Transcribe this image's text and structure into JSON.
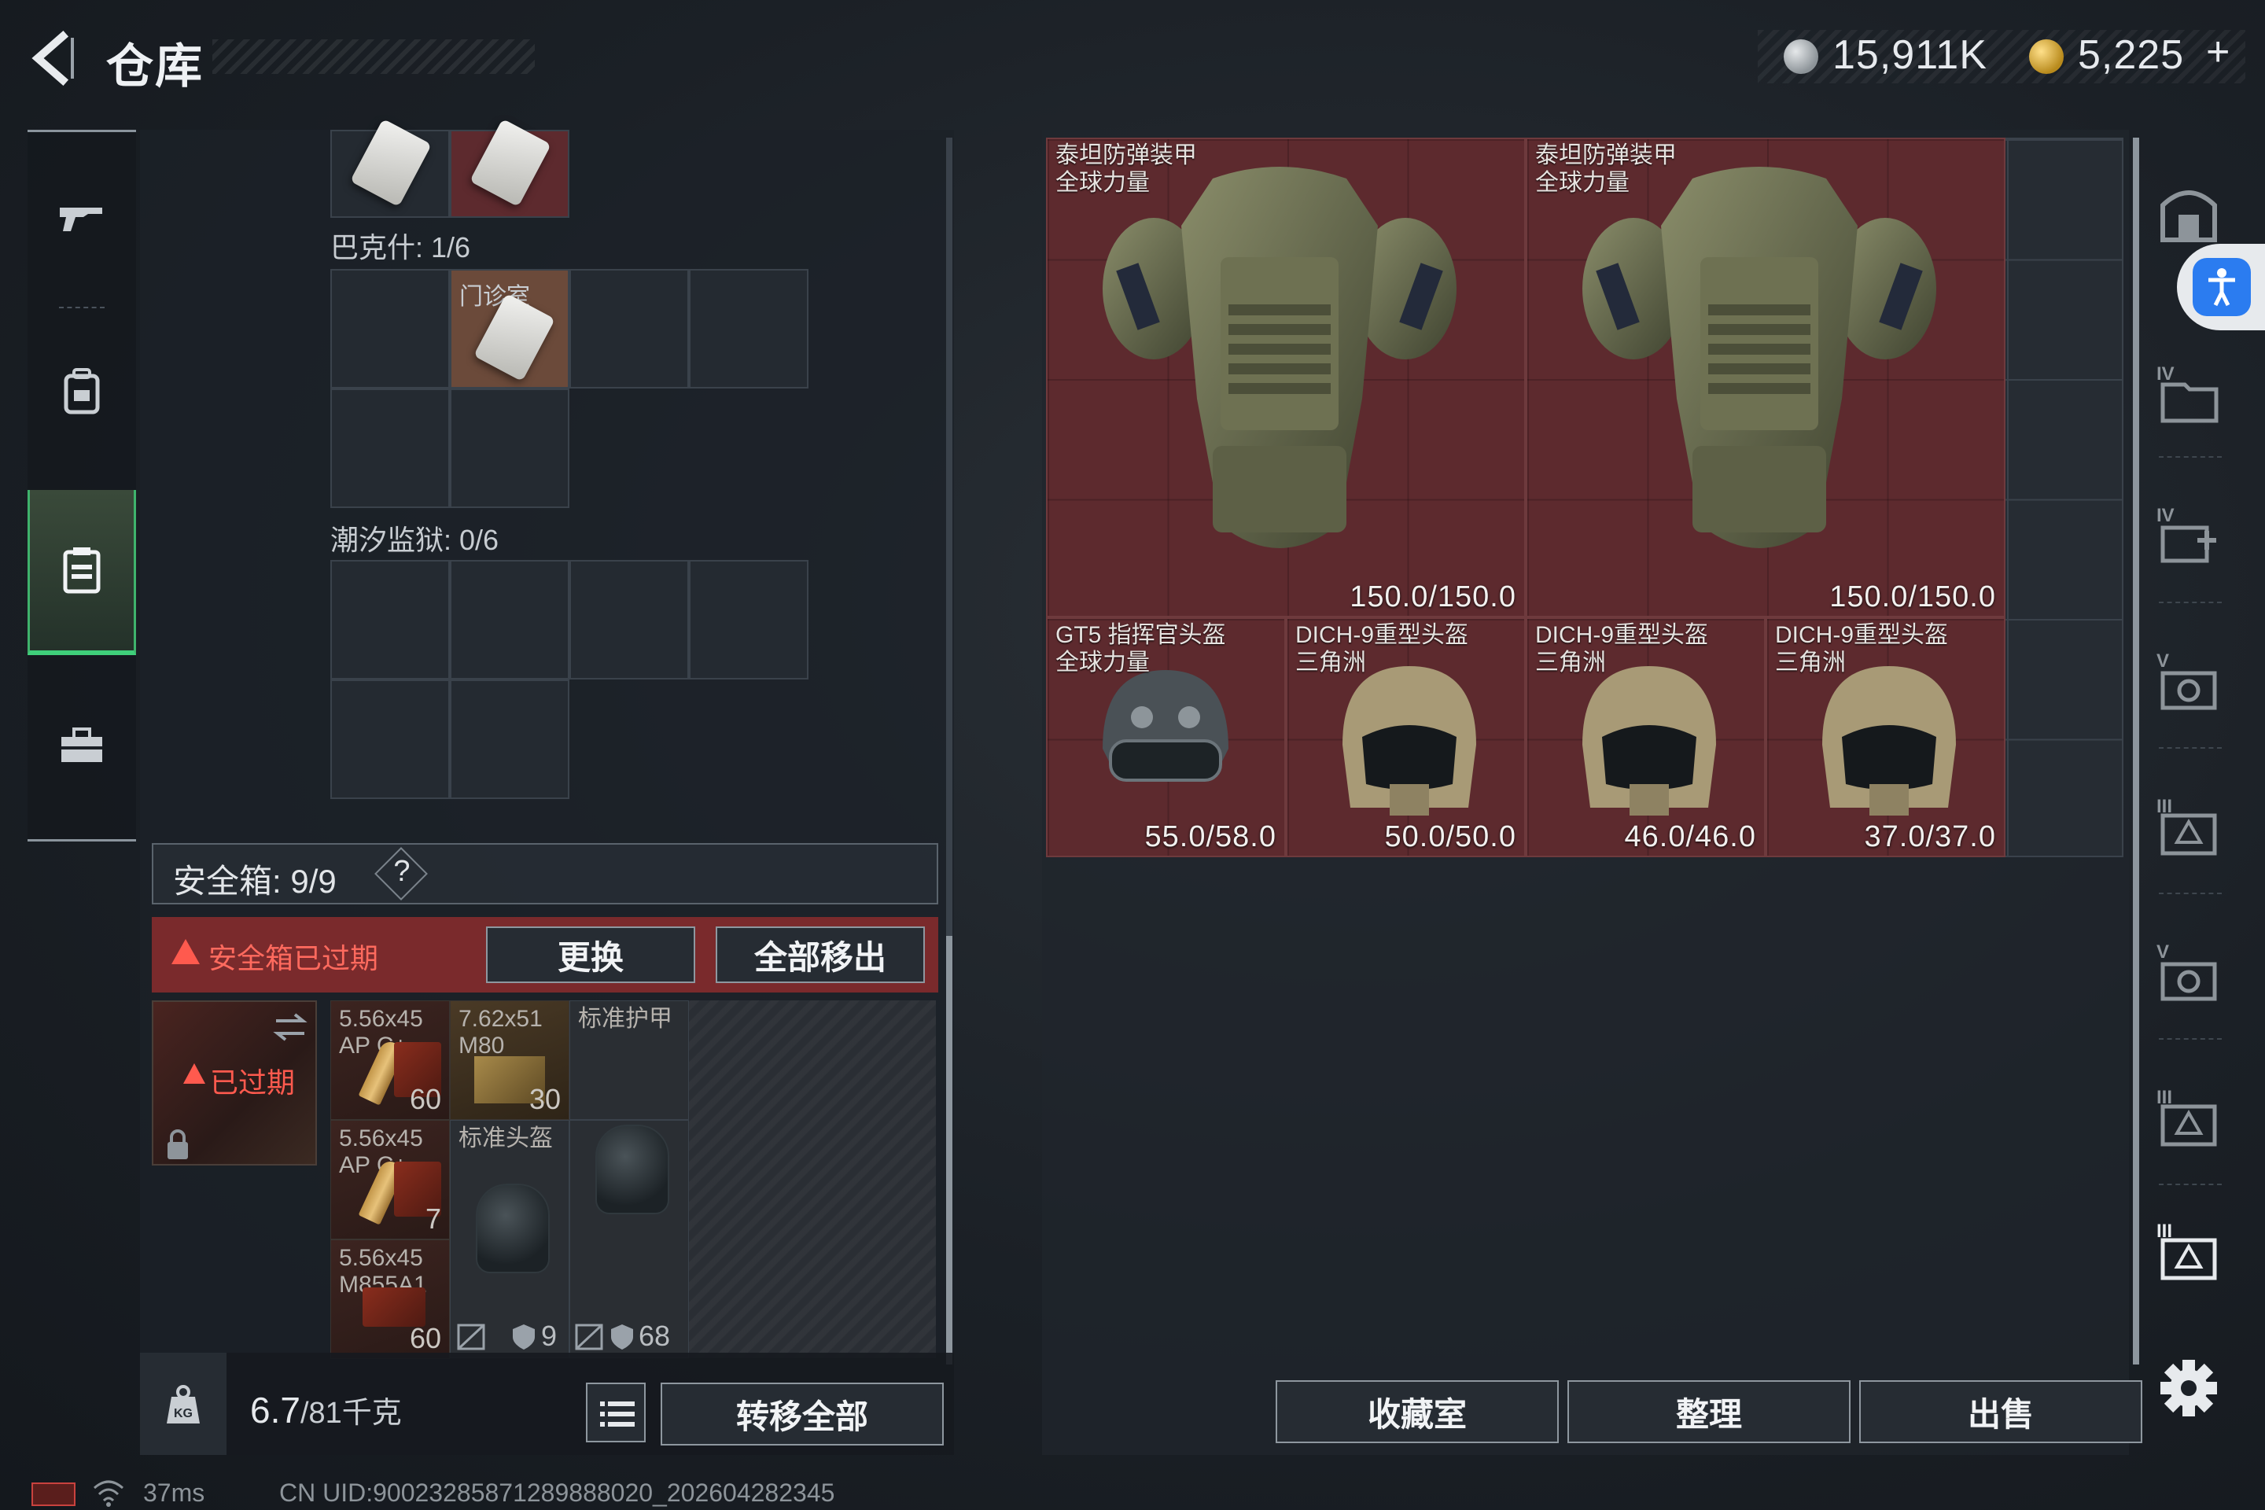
{
  "header": {
    "title": "仓库",
    "currency1_value": "15,911K",
    "currency2_value": "5,225",
    "currency2_add": "+"
  },
  "left_nav": {
    "items": [
      {
        "name": "weapons",
        "icon": "gun-icon"
      },
      {
        "name": "backpack",
        "icon": "backpack-icon"
      },
      {
        "name": "containers",
        "icon": "container-icon",
        "active": true
      },
      {
        "name": "toolbox",
        "icon": "toolbox-icon"
      }
    ]
  },
  "containers": {
    "top_card_label": "",
    "bakesh_label": "巴克什: 1/6",
    "clinic_key_label": "门诊室",
    "tide_prison_label": "潮汐监狱: 0/6"
  },
  "safe_box": {
    "label": "安全箱: 9/9",
    "help": "?",
    "expired_warning": "安全箱已过期",
    "replace_btn": "更换",
    "remove_all_btn": "全部移出",
    "thumb_status": "已过期",
    "items": [
      {
        "name": "5.56x45 AP C+",
        "count": "60"
      },
      {
        "name": "7.62x51 M80",
        "count": "30"
      },
      {
        "name": "标准护甲",
        "count": ""
      },
      {
        "name": "5.56x45 AP C+",
        "count": "7"
      },
      {
        "name": "标准头盔",
        "count": ""
      },
      {
        "name": "5.56x45 M855A1",
        "count": "60"
      }
    ],
    "armor_stat": "9",
    "helmet_stat": "68"
  },
  "bottom_left": {
    "weight_current": "6.7",
    "weight_max": "/81千克",
    "transfer_all_btn": "转移全部"
  },
  "stash": {
    "items": [
      {
        "name": "泰坦防弹装甲",
        "sub": "全球力量",
        "durability": "150.0/150.0"
      },
      {
        "name": "泰坦防弹装甲",
        "sub": "全球力量",
        "durability": "150.0/150.0"
      },
      {
        "name": "GT5 指挥官头盔",
        "sub": "全球力量",
        "durability": "55.0/58.0"
      },
      {
        "name": "DICH-9重型头盔",
        "sub": "三角洲",
        "durability": "50.0/50.0"
      },
      {
        "name": "DICH-9重型头盔",
        "sub": "三角洲",
        "durability": "46.0/46.0"
      },
      {
        "name": "DICH-9重型头盔",
        "sub": "三角洲",
        "durability": "37.0/37.0"
      }
    ],
    "collection_btn": "收藏室",
    "sort_btn": "整理",
    "sell_btn": "出售"
  },
  "right_rail": {
    "tiers": [
      "",
      "IV",
      "IV",
      "V",
      "III",
      "V",
      "III",
      "III"
    ]
  },
  "status_bar": {
    "ping": "37ms",
    "uid": "CN UID:9002328587128988802​0_202604282345"
  },
  "colors": {
    "accent_green": "#3fcf7a",
    "item_bg_red": "#5d2a2e",
    "warning_red": "#7a2a2c",
    "accessibility_blue": "#2b7cf0"
  }
}
